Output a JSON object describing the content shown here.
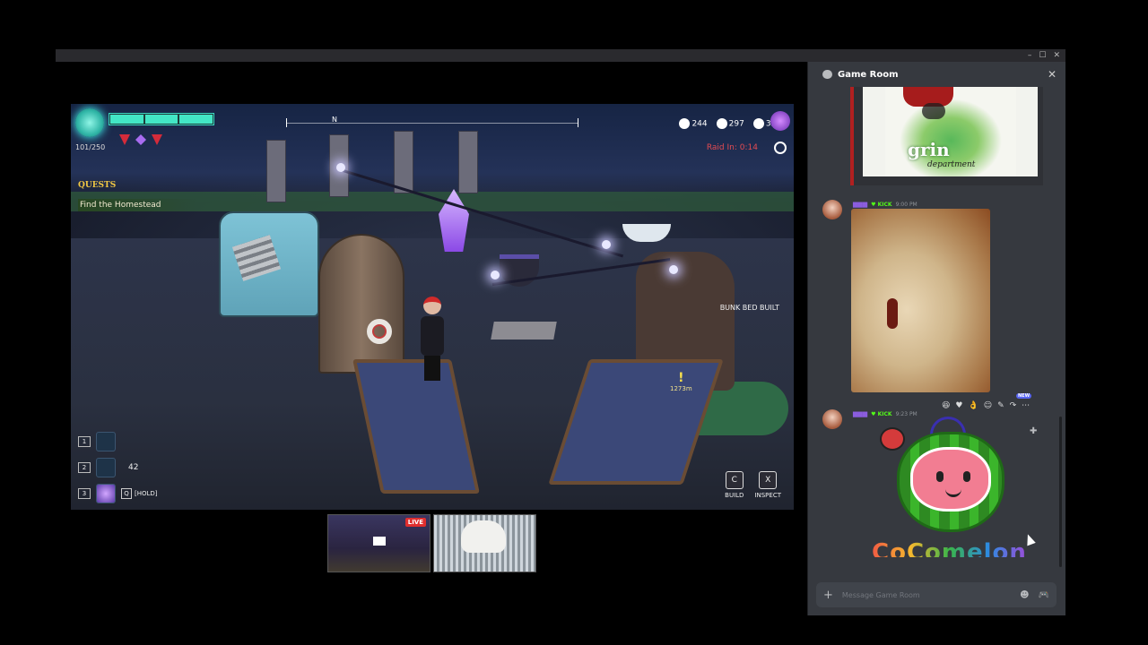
{
  "window": {
    "minimize_glyph": "–",
    "maximize_glyph": "☐",
    "close_glyph": "✕"
  },
  "game": {
    "energy": "101/250",
    "compass_north": "N",
    "resources": [
      {
        "icon": "water-drop-icon",
        "value": "244"
      },
      {
        "icon": "food-fork-icon",
        "value": "297"
      },
      {
        "icon": "shield-icon",
        "value": "325"
      }
    ],
    "raid_label": "Raid In:",
    "raid_timer": "0:14",
    "quests_title": "QUESTS",
    "quest_item": "Find the Homestead",
    "event_message": "BUNK BED BUILT",
    "distance": "1273m",
    "hotbar": [
      {
        "slot": "1",
        "count": ""
      },
      {
        "slot": "2",
        "count": "42"
      },
      {
        "slot": "3",
        "count": ""
      }
    ],
    "hold_key": "Q",
    "hold_label": "[HOLD]",
    "build_key": "C",
    "build_label": "BUILD",
    "inspect_key": "X",
    "inspect_label": "INSPECT"
  },
  "thumbnails": {
    "live_badge": "LIVE"
  },
  "chat": {
    "title": "Game Room",
    "poster_text": "grin",
    "poster_text2": "department",
    "messages": [
      {
        "badge": "KICK",
        "time": "9:00 PM"
      },
      {
        "badge": "KICK",
        "time": "9:23 PM"
      }
    ],
    "reactions_new": "NEW",
    "sticker_text": "CoComelon",
    "composer_placeholder": "Message Game Room"
  },
  "colors": {
    "discord_bg": "#36393f",
    "accent_kick": "#53fc18",
    "live_red": "#e02e2e",
    "health": "#43e6c5"
  }
}
